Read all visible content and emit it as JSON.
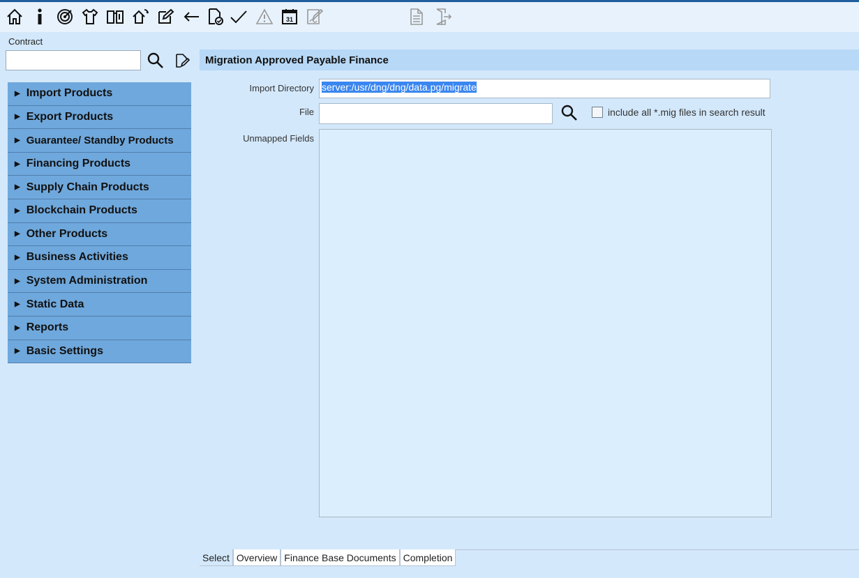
{
  "toolbar": {
    "icons": [
      {
        "name": "home-icon"
      },
      {
        "name": "info-icon"
      },
      {
        "name": "target-icon"
      },
      {
        "name": "shirt-icon"
      },
      {
        "name": "book-icon"
      },
      {
        "name": "house-sync-icon"
      },
      {
        "name": "edit-icon"
      },
      {
        "name": "back-arrow-icon"
      },
      {
        "name": "document-check-icon"
      },
      {
        "name": "checkmark-icon"
      },
      {
        "name": "warning-icon"
      },
      {
        "name": "calendar-icon"
      },
      {
        "name": "signature-icon"
      },
      {
        "name": "document-icon"
      },
      {
        "name": "exit-icon"
      }
    ],
    "calendar_day": "31"
  },
  "contract": {
    "label": "Contract",
    "value": ""
  },
  "menu": {
    "items": [
      {
        "label": "Import Products"
      },
      {
        "label": "Export Products"
      },
      {
        "label": "Guarantee/ Standby Products"
      },
      {
        "label": "Financing Products"
      },
      {
        "label": "Supply Chain Products"
      },
      {
        "label": "Blockchain Products"
      },
      {
        "label": "Other Products"
      },
      {
        "label": "Business Activities"
      },
      {
        "label": "System Administration"
      },
      {
        "label": "Static Data"
      },
      {
        "label": "Reports"
      },
      {
        "label": "Basic Settings"
      }
    ]
  },
  "panel": {
    "title": "Migration Approved Payable Finance",
    "import_directory_label": "Import Directory",
    "import_directory_value": "server:/usr/dng/dng/data.pg/migrate",
    "file_label": "File",
    "file_value": "",
    "include_label": "include all *.mig files in search result",
    "include_checked": false,
    "unmapped_label": "Unmapped Fields"
  },
  "tabs": [
    {
      "label": "Select"
    },
    {
      "label": "Overview"
    },
    {
      "label": "Finance Base Documents"
    },
    {
      "label": "Completion"
    }
  ],
  "colors": {
    "background": "#d3e8fb",
    "menu_item": "#6fa8dc",
    "header": "#b7d8f6",
    "selection": "#3a86f0"
  }
}
